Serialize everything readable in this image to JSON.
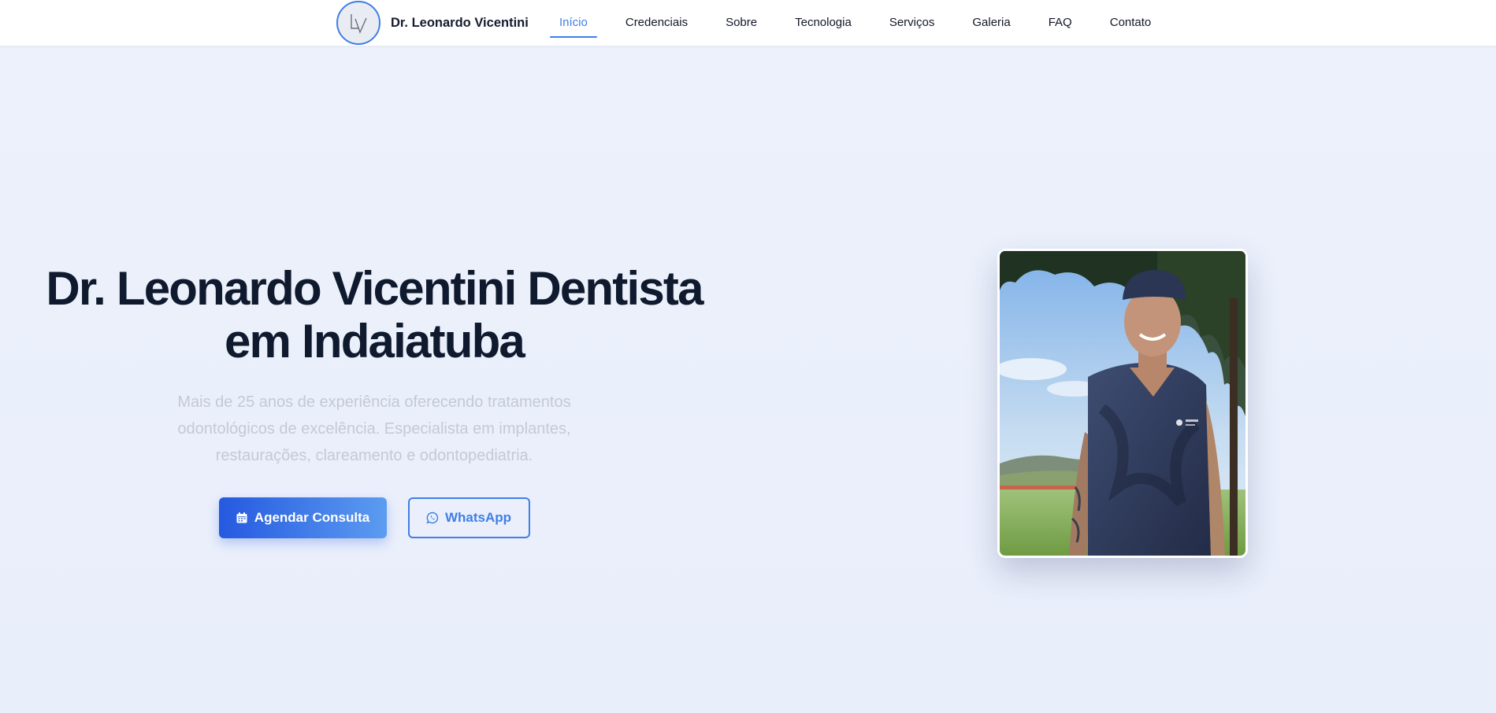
{
  "brand": {
    "name": "Dr. Leonardo Vicentini",
    "logo_icon": "lv-monogram-logo"
  },
  "nav": {
    "items": [
      {
        "label": "Início",
        "active": true
      },
      {
        "label": "Credenciais",
        "active": false
      },
      {
        "label": "Sobre",
        "active": false
      },
      {
        "label": "Tecnologia",
        "active": false
      },
      {
        "label": "Serviços",
        "active": false
      },
      {
        "label": "Galeria",
        "active": false
      },
      {
        "label": "FAQ",
        "active": false
      },
      {
        "label": "Contato",
        "active": false
      }
    ]
  },
  "hero": {
    "title_line1": "Dr. Leonardo Vicentini Dentista",
    "title_line2": "em Indaiatuba",
    "description": "Mais de 25 anos de experiência oferecendo tratamentos odontológicos de excelência. Especialista em implantes, restaurações, clareamento e odontopediatria.",
    "primary_button": {
      "label": "Agendar Consulta",
      "icon": "calendar-icon"
    },
    "secondary_button": {
      "label": "WhatsApp",
      "icon": "whatsapp-icon"
    },
    "photo": {
      "subject": "dentist-portrait-photo"
    }
  },
  "colors": {
    "accent": "#3f7fe6",
    "primary_gradient_start": "#2559e0",
    "primary_gradient_end": "#5c9cf0",
    "title": "#0f1a2e",
    "description": "#c4c9d3",
    "hero_background": "#eaeffb"
  }
}
